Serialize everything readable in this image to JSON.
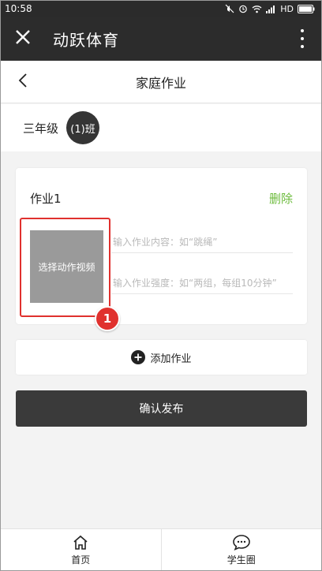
{
  "status_bar": {
    "time": "10:58",
    "network": "HD",
    "icons": [
      "mute-icon",
      "alarm-icon",
      "wifi-icon",
      "signal-icon",
      "battery-icon"
    ]
  },
  "app_bar": {
    "title": "动跃体育",
    "close_icon": "close-icon",
    "more_icon": "more-vertical-icon"
  },
  "page_header": {
    "title": "家庭作业",
    "back_icon": "chevron-left-icon"
  },
  "class_info": {
    "grade": "三年级",
    "class_name": "(1)班"
  },
  "homework_items": [
    {
      "title": "作业1",
      "delete_label": "删除",
      "video_picker_label": "选择动作视频",
      "content_placeholder": "输入作业内容：如“跳绳”",
      "intensity_placeholder": "输入作业强度：如“两组，每组10分钟”",
      "step_badge": "1"
    }
  ],
  "actions": {
    "add_label": "添加作业",
    "confirm_label": "确认发布"
  },
  "tab_bar": {
    "tabs": [
      {
        "label": "首页",
        "icon": "home-icon"
      },
      {
        "label": "学生圈",
        "icon": "chat-icon"
      }
    ]
  },
  "colors": {
    "app_bar": "#2c2c2c",
    "accent_green": "#6cbb3c",
    "highlight_red": "#e0312e",
    "button_dark": "#3a3a3a",
    "picker_gray": "#9a9a9a"
  }
}
